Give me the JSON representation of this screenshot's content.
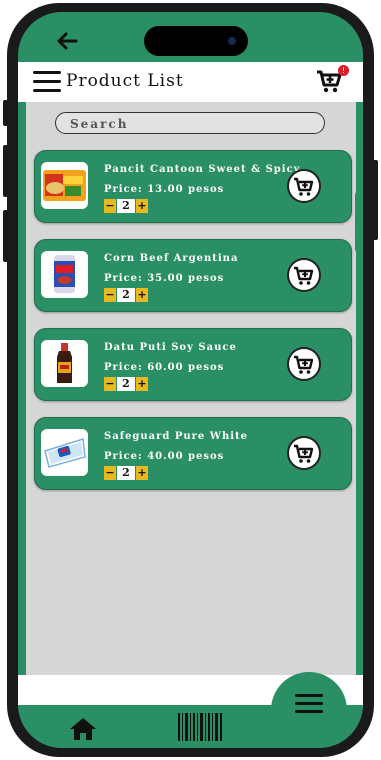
{
  "header": {
    "title": "Product List",
    "cart_count": "!"
  },
  "search": {
    "placeholder": "Search"
  },
  "products": [
    {
      "name": "Pancit Cantoon Sweet & Spicy",
      "price": "Price: 13.00 pesos",
      "qty": "2",
      "minus": "−",
      "plus": "+"
    },
    {
      "name": "Corn Beef Argentina",
      "price": "Price: 35.00 pesos",
      "qty": "2",
      "minus": "−",
      "plus": "+"
    },
    {
      "name": "Datu Puti Soy Sauce",
      "price": "Price: 60.00 pesos",
      "qty": "2",
      "minus": "−",
      "plus": "+"
    },
    {
      "name": "Safeguard Pure White",
      "price": "Price: 40.00 pesos",
      "qty": "2",
      "minus": "−",
      "plus": "+"
    }
  ],
  "colors": {
    "primary": "#2a8f64",
    "accent": "#e8b820",
    "background": "#d6d6d6",
    "badge": "#e01b24"
  },
  "icons": {
    "back": "arrow-left-icon",
    "menu": "hamburger-icon",
    "cart": "cart-plus-icon",
    "home": "home-icon",
    "barcode": "barcode-icon"
  }
}
